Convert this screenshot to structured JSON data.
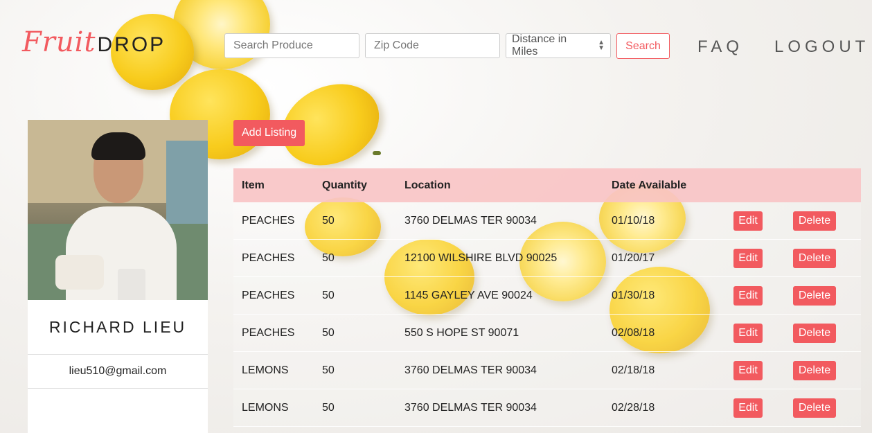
{
  "header": {
    "logo_script": "Fruit",
    "logo_bold": "DROP",
    "search_placeholder": "Search Produce",
    "zip_placeholder": "Zip Code",
    "distance_selected": "Distance in Miles",
    "search_label": "Search",
    "nav": [
      {
        "label": "FAQ"
      },
      {
        "label": "LOGOUT"
      }
    ]
  },
  "profile": {
    "name": "RICHARD LIEU",
    "email": "lieu510@gmail.com"
  },
  "actions": {
    "add_listing_label": "Add Listing"
  },
  "listings": {
    "columns": [
      "Item",
      "Quantity",
      "Location",
      "Date Available"
    ],
    "edit_label": "Edit",
    "delete_label": "Delete",
    "rows": [
      {
        "item": "PEACHES",
        "quantity": "50",
        "location": "3760 DELMAS TER 90034",
        "date": "01/10/18"
      },
      {
        "item": "PEACHES",
        "quantity": "50",
        "location": "12100 WILSHIRE BLVD 90025",
        "date": "01/20/17"
      },
      {
        "item": "PEACHES",
        "quantity": "50",
        "location": "1145 GAYLEY AVE 90024",
        "date": "01/30/18"
      },
      {
        "item": "PEACHES",
        "quantity": "50",
        "location": "550 S HOPE ST 90071",
        "date": "02/08/18"
      },
      {
        "item": "LEMONS",
        "quantity": "50",
        "location": "3760 DELMAS TER 90034",
        "date": "02/18/18"
      },
      {
        "item": "LEMONS",
        "quantity": "50",
        "location": "3760 DELMAS TER 90034",
        "date": "02/28/18"
      }
    ]
  },
  "colors": {
    "accent": "#f25a5f",
    "table_header": "#f8c4c6"
  }
}
